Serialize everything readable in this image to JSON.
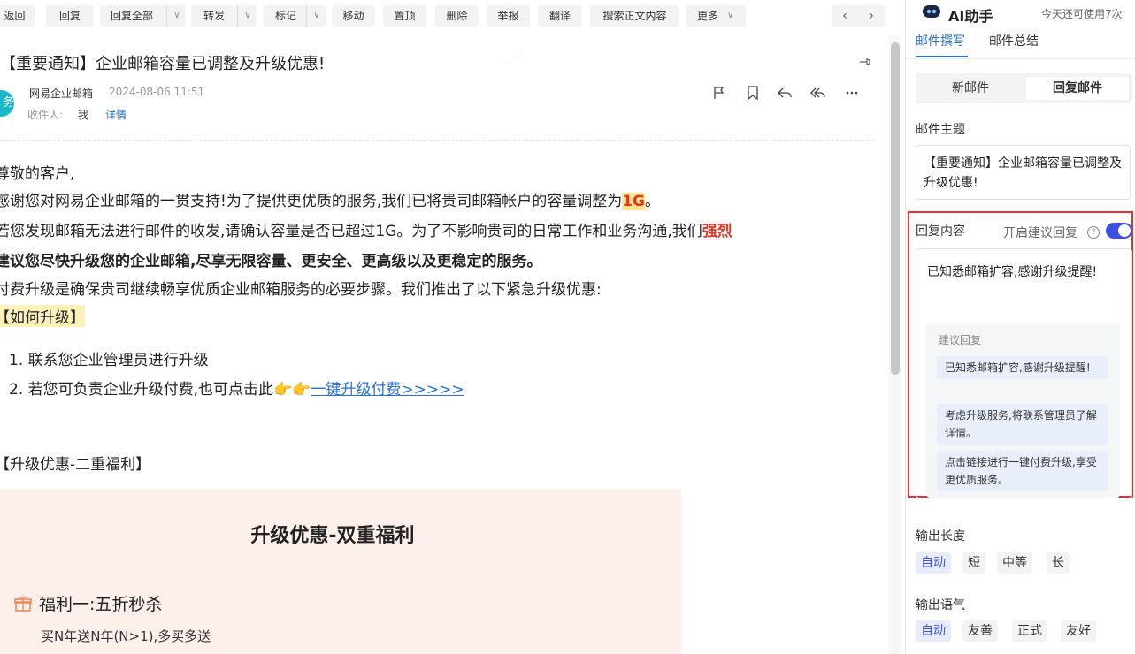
{
  "toolbar": {
    "back": "返回",
    "reply": "回复",
    "reply_all": "回复全部",
    "forward": "转发",
    "mark": "标记",
    "move": "移动",
    "pin_top": "置顶",
    "delete": "删除",
    "report": "举报",
    "translate": "翻译",
    "search_body": "搜索正文内容",
    "more": "更多",
    "prev": "‹",
    "next": "›"
  },
  "email": {
    "subject": "【重要通知】企业邮箱容量已调整及升级优惠!",
    "avatar_text": "务",
    "sender": "网易企业邮箱",
    "date": "2024-08-06 11:51",
    "recipient_label": "收件人:",
    "recipient": "我",
    "details_link": "详情",
    "greeting": "尊敬的客户,",
    "p1_a": "感谢您对网易企业邮箱的一贯支持!为了提供更优质的服务,我们已将贵司邮箱帐户的容量调整为",
    "p1_hl": "1G",
    "p1_b": "。",
    "p2_a": "若您发现邮箱无法进行邮件的收发,请确认容量是否已超过1G。为了不影响贵司的日常工作和业务沟通,我们",
    "p2_red": "强烈",
    "p3_red": "建议您尽快升级您的企业邮箱,尽享无限容量、更安全、更高级以及更稳定的服务。",
    "p4": "付费升级是确保贵司继续畅享优质企业邮箱服务的必要步骤。我们推出了以下紧急升级优惠:",
    "how_heading": "【如何升级】",
    "step1": "1. 联系您企业管理员进行升级",
    "step2_a": "2. 若您可负责企业升级付费,也可点击此",
    "step2_link": "一键升级付费>>>>>",
    "benefit_heading": "【升级优惠-二重福利】",
    "banner_title": "升级优惠-双重福利",
    "benefit1_title": "福利一:五折秒杀",
    "benefit1_desc": "买N年送N年(N>1),多买多送"
  },
  "ai": {
    "title": "AI助手",
    "quota": "今天还可使用7次",
    "tab_write": "邮件撰写",
    "tab_summary": "邮件总结",
    "seg_new": "新邮件",
    "seg_reply": "回复邮件",
    "subject_label": "邮件主题",
    "subject_value": "【重要通知】企业邮箱容量已调整及升级优惠!",
    "reply_label": "回复内容",
    "suggest_toggle_label": "开启建议回复",
    "suggest_toggle_on": true,
    "reply_text": "已知悉邮箱扩容,感谢升级提醒!",
    "suggestions_title": "建议回复",
    "suggestions": [
      "已知悉邮箱扩容,感谢升级提醒!",
      "考虑升级服务,将联系管理员了解详情。",
      "点击链接进行一键付费升级,享受更优质服务。"
    ],
    "length_label": "输出长度",
    "length_options": [
      "自动",
      "短",
      "中等",
      "长"
    ],
    "length_selected": "自动",
    "tone_label": "输出语气",
    "tone_options": [
      "自动",
      "友善",
      "正式",
      "友好"
    ],
    "tone_selected": "自动"
  },
  "colors": {
    "accent": "#2a6fd4",
    "toggle": "#3d4fe0",
    "alert_red": "#e53524",
    "highlight_box": "#e53238"
  }
}
